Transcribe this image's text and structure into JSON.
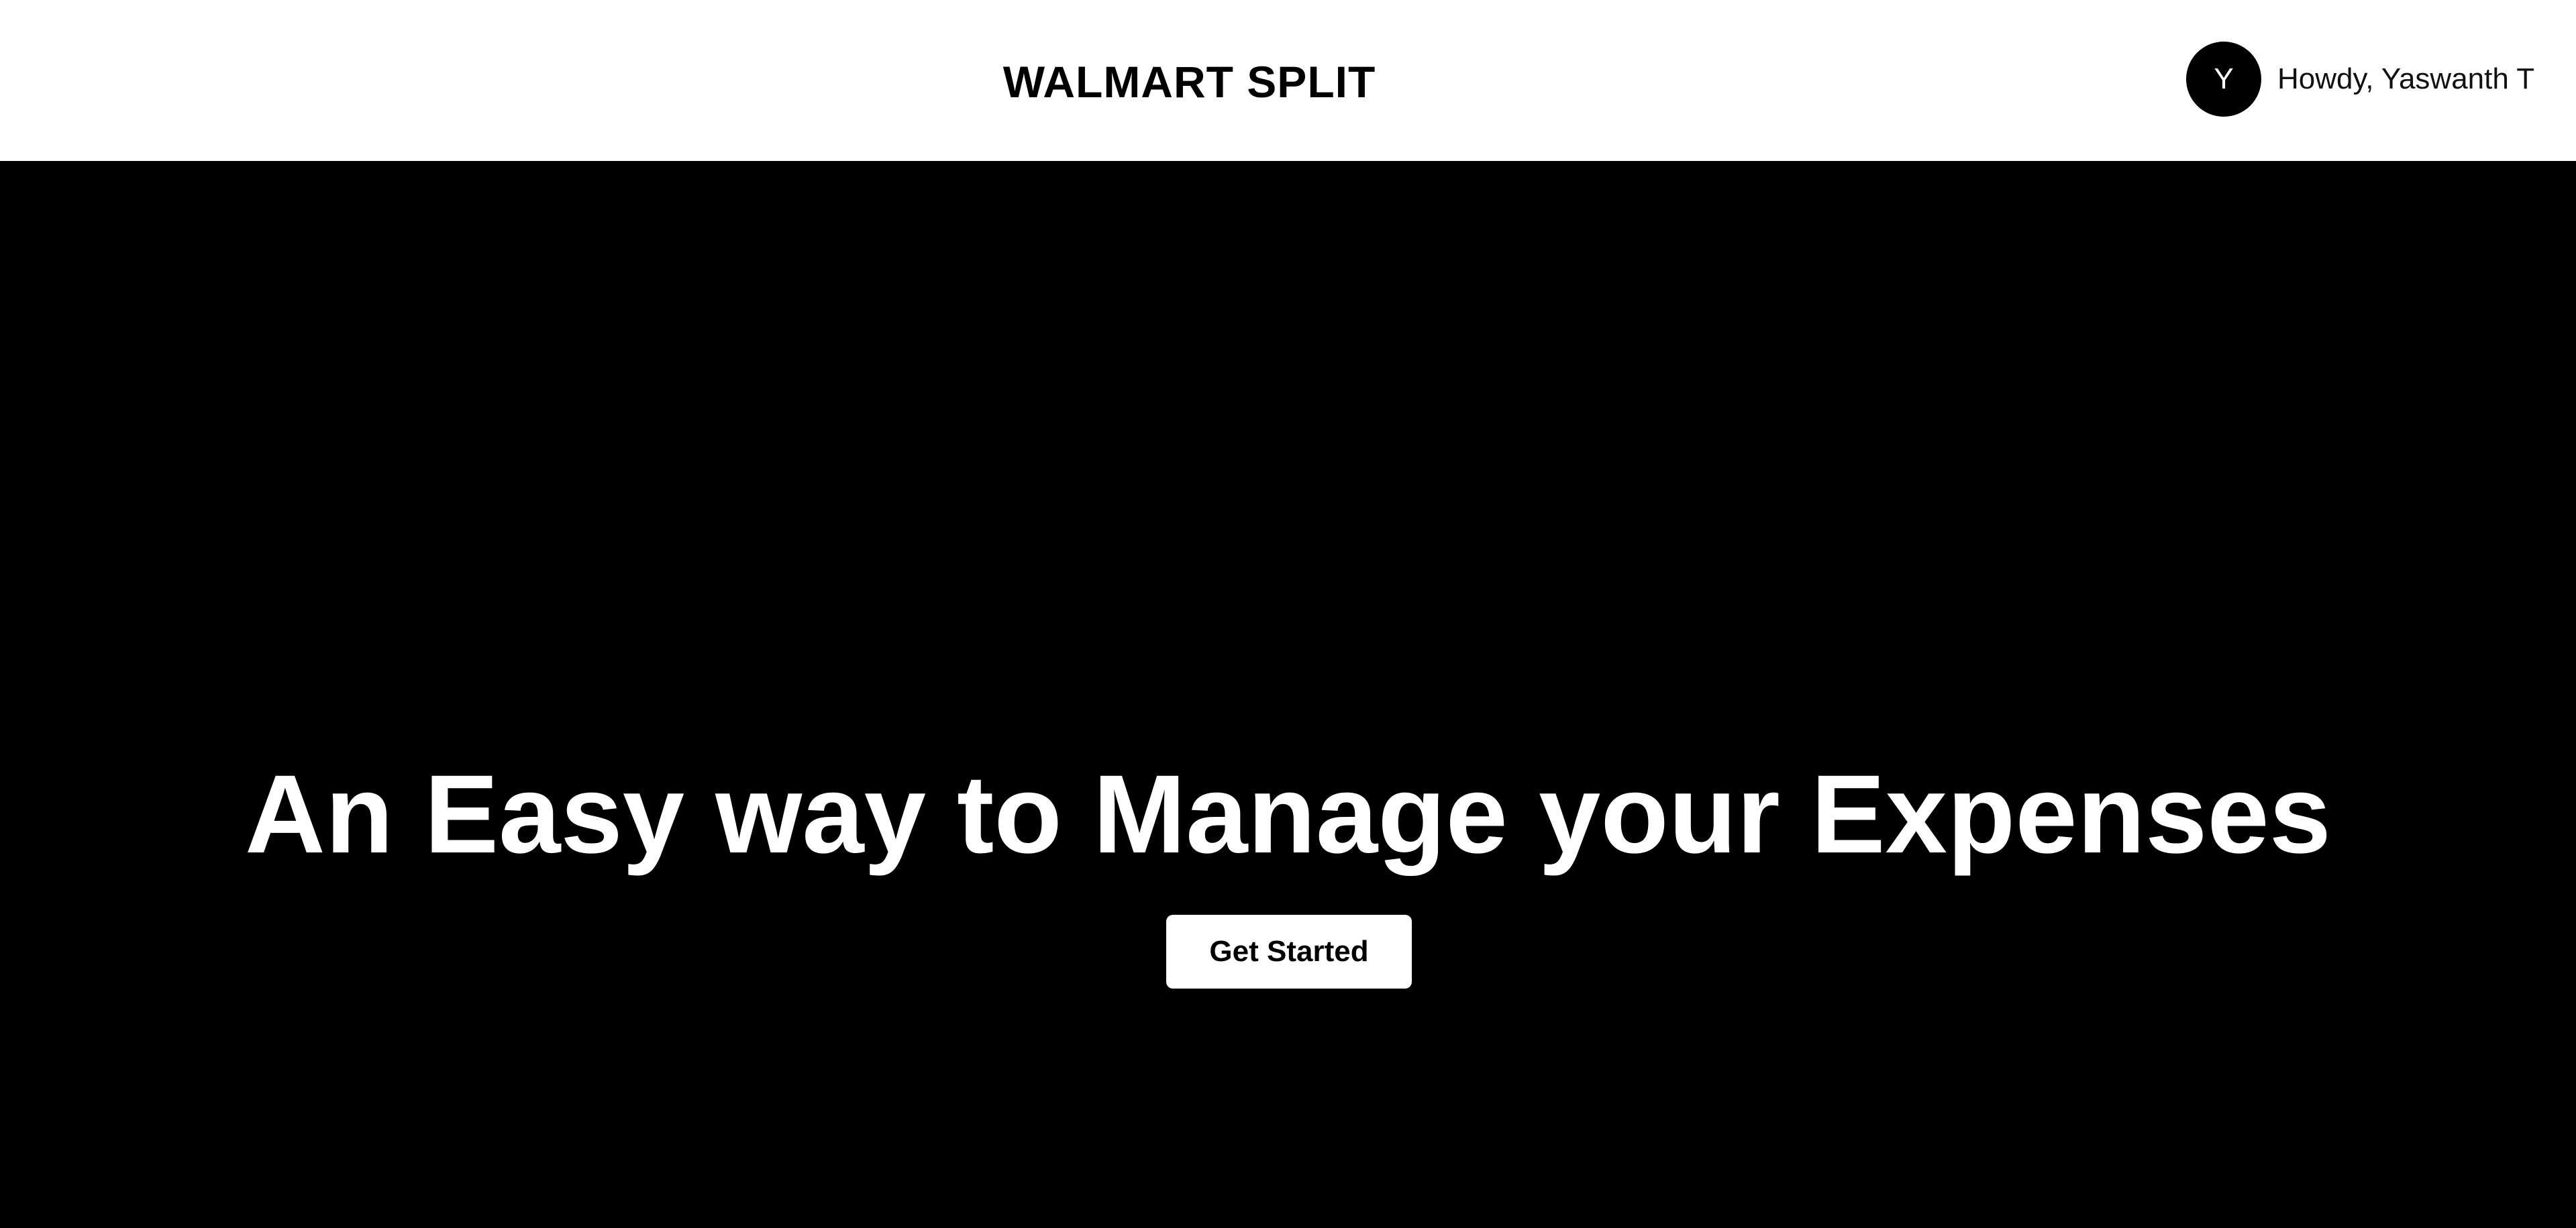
{
  "header": {
    "brand": "WALMART SPLIT",
    "user": {
      "avatar_initial": "Y",
      "greeting": "Howdy, Yaswanth T"
    }
  },
  "hero": {
    "title": "An Easy way to Manage your Expenses",
    "cta_label": "Get Started"
  },
  "colors": {
    "header_background": "#ffffff",
    "hero_background": "#000000",
    "avatar_background": "#000000",
    "button_background": "#ffffff"
  }
}
